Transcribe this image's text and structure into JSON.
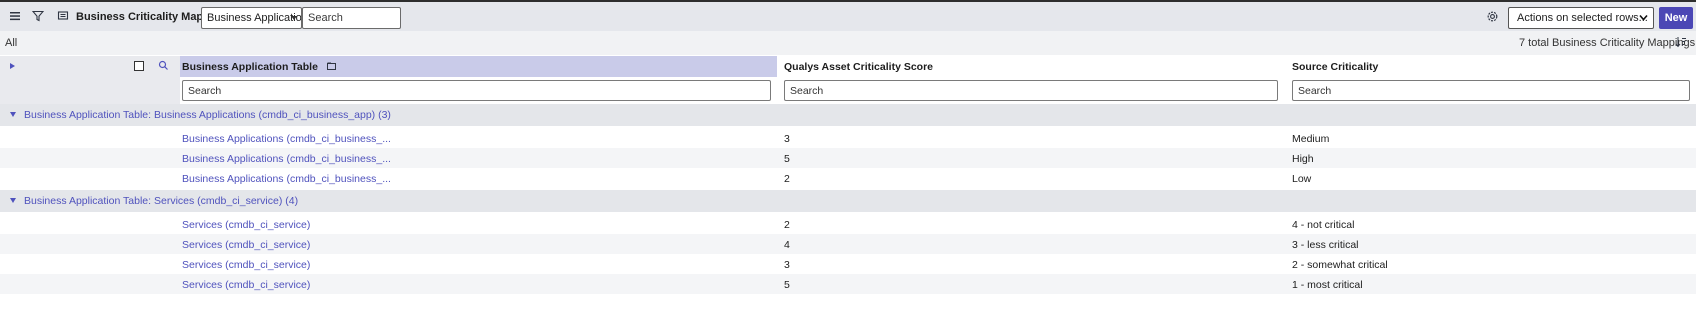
{
  "toolbar": {
    "title": "Business Criticality Mappings",
    "field_select_value": "Business Applicatior",
    "search_placeholder": "Search",
    "actions_select_value": "Actions on selected rows...",
    "new_label": "New",
    "icons": [
      "hamburger-menu-icon",
      "filter-icon",
      "list-context-icon",
      "gear-icon"
    ]
  },
  "subbar": {
    "breadcrumb": "All",
    "total_count": "7 total Business Criticality Mappings"
  },
  "columns": [
    {
      "label": "Business Application Table",
      "search_placeholder": "Search"
    },
    {
      "label": "Qualys Asset Criticality Score",
      "search_placeholder": "Search"
    },
    {
      "label": "Source Criticality",
      "search_placeholder": "Search"
    }
  ],
  "groups": [
    {
      "label": "Business Application Table: Business Applications (cmdb_ci_business_app) (3)",
      "rows": [
        {
          "table": "Business Applications (cmdb_ci_business_...",
          "score": "3",
          "source": "Medium"
        },
        {
          "table": "Business Applications (cmdb_ci_business_...",
          "score": "5",
          "source": "High"
        },
        {
          "table": "Business Applications (cmdb_ci_business_...",
          "score": "2",
          "source": "Low"
        }
      ]
    },
    {
      "label": "Business Application Table: Services (cmdb_ci_service) (4)",
      "rows": [
        {
          "table": "Services (cmdb_ci_service)",
          "score": "2",
          "source": "4 - not critical"
        },
        {
          "table": "Services (cmdb_ci_service)",
          "score": "4",
          "source": "3 - less critical"
        },
        {
          "table": "Services (cmdb_ci_service)",
          "score": "3",
          "source": "2 - somewhat critical"
        },
        {
          "table": "Services (cmdb_ci_service)",
          "score": "5",
          "source": "1 - most critical"
        }
      ]
    }
  ],
  "colors": {
    "accent": "#4b47b5",
    "link": "#4f52bd",
    "header_active": "#c9cbe9",
    "toolbar_bg": "#e5e7ec",
    "group_bg": "#e4e6ea"
  }
}
